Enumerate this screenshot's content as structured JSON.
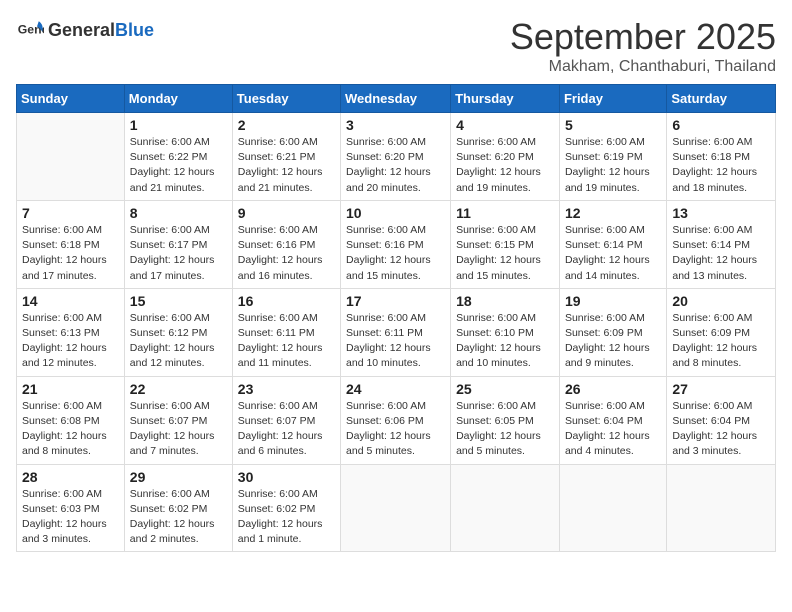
{
  "header": {
    "logo_general": "General",
    "logo_blue": "Blue",
    "month": "September 2025",
    "location": "Makham, Chanthaburi, Thailand"
  },
  "days_of_week": [
    "Sunday",
    "Monday",
    "Tuesday",
    "Wednesday",
    "Thursday",
    "Friday",
    "Saturday"
  ],
  "weeks": [
    [
      {
        "day": "",
        "info": ""
      },
      {
        "day": "1",
        "info": "Sunrise: 6:00 AM\nSunset: 6:22 PM\nDaylight: 12 hours\nand 21 minutes."
      },
      {
        "day": "2",
        "info": "Sunrise: 6:00 AM\nSunset: 6:21 PM\nDaylight: 12 hours\nand 21 minutes."
      },
      {
        "day": "3",
        "info": "Sunrise: 6:00 AM\nSunset: 6:20 PM\nDaylight: 12 hours\nand 20 minutes."
      },
      {
        "day": "4",
        "info": "Sunrise: 6:00 AM\nSunset: 6:20 PM\nDaylight: 12 hours\nand 19 minutes."
      },
      {
        "day": "5",
        "info": "Sunrise: 6:00 AM\nSunset: 6:19 PM\nDaylight: 12 hours\nand 19 minutes."
      },
      {
        "day": "6",
        "info": "Sunrise: 6:00 AM\nSunset: 6:18 PM\nDaylight: 12 hours\nand 18 minutes."
      }
    ],
    [
      {
        "day": "7",
        "info": "Sunrise: 6:00 AM\nSunset: 6:18 PM\nDaylight: 12 hours\nand 17 minutes."
      },
      {
        "day": "8",
        "info": "Sunrise: 6:00 AM\nSunset: 6:17 PM\nDaylight: 12 hours\nand 17 minutes."
      },
      {
        "day": "9",
        "info": "Sunrise: 6:00 AM\nSunset: 6:16 PM\nDaylight: 12 hours\nand 16 minutes."
      },
      {
        "day": "10",
        "info": "Sunrise: 6:00 AM\nSunset: 6:16 PM\nDaylight: 12 hours\nand 15 minutes."
      },
      {
        "day": "11",
        "info": "Sunrise: 6:00 AM\nSunset: 6:15 PM\nDaylight: 12 hours\nand 15 minutes."
      },
      {
        "day": "12",
        "info": "Sunrise: 6:00 AM\nSunset: 6:14 PM\nDaylight: 12 hours\nand 14 minutes."
      },
      {
        "day": "13",
        "info": "Sunrise: 6:00 AM\nSunset: 6:14 PM\nDaylight: 12 hours\nand 13 minutes."
      }
    ],
    [
      {
        "day": "14",
        "info": "Sunrise: 6:00 AM\nSunset: 6:13 PM\nDaylight: 12 hours\nand 12 minutes."
      },
      {
        "day": "15",
        "info": "Sunrise: 6:00 AM\nSunset: 6:12 PM\nDaylight: 12 hours\nand 12 minutes."
      },
      {
        "day": "16",
        "info": "Sunrise: 6:00 AM\nSunset: 6:11 PM\nDaylight: 12 hours\nand 11 minutes."
      },
      {
        "day": "17",
        "info": "Sunrise: 6:00 AM\nSunset: 6:11 PM\nDaylight: 12 hours\nand 10 minutes."
      },
      {
        "day": "18",
        "info": "Sunrise: 6:00 AM\nSunset: 6:10 PM\nDaylight: 12 hours\nand 10 minutes."
      },
      {
        "day": "19",
        "info": "Sunrise: 6:00 AM\nSunset: 6:09 PM\nDaylight: 12 hours\nand 9 minutes."
      },
      {
        "day": "20",
        "info": "Sunrise: 6:00 AM\nSunset: 6:09 PM\nDaylight: 12 hours\nand 8 minutes."
      }
    ],
    [
      {
        "day": "21",
        "info": "Sunrise: 6:00 AM\nSunset: 6:08 PM\nDaylight: 12 hours\nand 8 minutes."
      },
      {
        "day": "22",
        "info": "Sunrise: 6:00 AM\nSunset: 6:07 PM\nDaylight: 12 hours\nand 7 minutes."
      },
      {
        "day": "23",
        "info": "Sunrise: 6:00 AM\nSunset: 6:07 PM\nDaylight: 12 hours\nand 6 minutes."
      },
      {
        "day": "24",
        "info": "Sunrise: 6:00 AM\nSunset: 6:06 PM\nDaylight: 12 hours\nand 5 minutes."
      },
      {
        "day": "25",
        "info": "Sunrise: 6:00 AM\nSunset: 6:05 PM\nDaylight: 12 hours\nand 5 minutes."
      },
      {
        "day": "26",
        "info": "Sunrise: 6:00 AM\nSunset: 6:04 PM\nDaylight: 12 hours\nand 4 minutes."
      },
      {
        "day": "27",
        "info": "Sunrise: 6:00 AM\nSunset: 6:04 PM\nDaylight: 12 hours\nand 3 minutes."
      }
    ],
    [
      {
        "day": "28",
        "info": "Sunrise: 6:00 AM\nSunset: 6:03 PM\nDaylight: 12 hours\nand 3 minutes."
      },
      {
        "day": "29",
        "info": "Sunrise: 6:00 AM\nSunset: 6:02 PM\nDaylight: 12 hours\nand 2 minutes."
      },
      {
        "day": "30",
        "info": "Sunrise: 6:00 AM\nSunset: 6:02 PM\nDaylight: 12 hours\nand 1 minute."
      },
      {
        "day": "",
        "info": ""
      },
      {
        "day": "",
        "info": ""
      },
      {
        "day": "",
        "info": ""
      },
      {
        "day": "",
        "info": ""
      }
    ]
  ]
}
